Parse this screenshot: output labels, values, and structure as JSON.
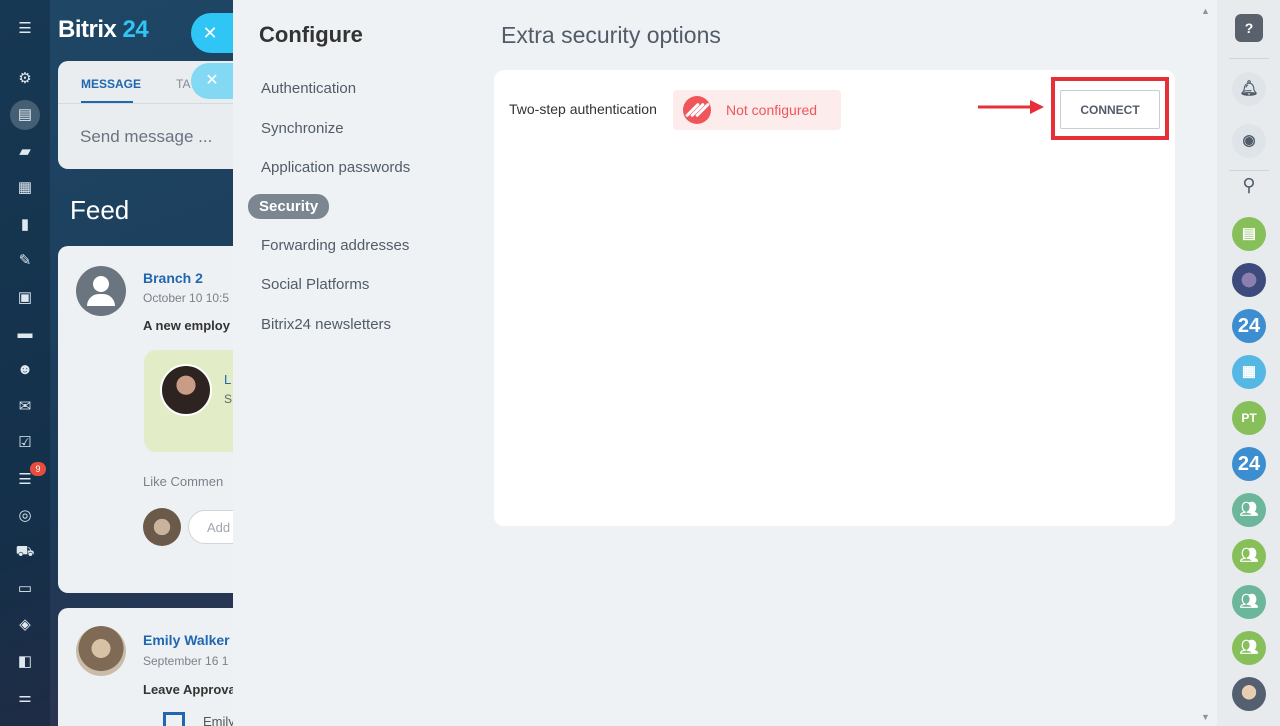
{
  "app": {
    "logo_text": "Bitrix",
    "logo_number": "24",
    "close_symbol": "✕",
    "nav_badge": "9",
    "nav_icons": [
      "companies-icon",
      "feed-icon",
      "chat-icon",
      "calendar-icon",
      "documents-icon",
      "sign-icon",
      "robot-icon",
      "drive-icon",
      "employees-icon",
      "mail-icon",
      "tasks-icon",
      "crm-icon",
      "goals-icon",
      "shop-icon",
      "contacts-icon",
      "inventory-icon",
      "automation-icon",
      "settings-icon"
    ]
  },
  "background": {
    "tabs": [
      "MESSAGE",
      "TA"
    ],
    "message_placeholder": "Send message ...",
    "feed_title": "Feed",
    "post1": {
      "author": "Branch 2",
      "date": "October 10 10:5",
      "text": "A new employ",
      "card_initial": "L",
      "card_sub": "S",
      "actions": "Like    Commen",
      "add_comment": "Add"
    },
    "post2": {
      "author": "Emily Walker",
      "date": "September 16 1",
      "text": "Leave Approva",
      "sub": "Emily"
    }
  },
  "panel": {
    "title": "Configure",
    "menu": [
      {
        "label": "Authentication",
        "active": false
      },
      {
        "label": "Synchronize",
        "active": false
      },
      {
        "label": "Application passwords",
        "active": false
      },
      {
        "label": "Security",
        "active": true
      },
      {
        "label": "Forwarding addresses",
        "active": false
      },
      {
        "label": "Social Platforms",
        "active": false
      },
      {
        "label": "Bitrix24 newsletters",
        "active": false
      }
    ],
    "section_title": "Extra security options",
    "two_step": {
      "label": "Two-step authentication",
      "status": "Not configured",
      "status_color": "#f0555a",
      "button": "CONNECT",
      "highlight_color": "#e62f36"
    }
  },
  "right_bar": {
    "help_symbol": "?",
    "initials": "PT",
    "logo_24": "24"
  },
  "colors": {
    "accent": "#2fc6f6",
    "link": "#2067b0"
  }
}
